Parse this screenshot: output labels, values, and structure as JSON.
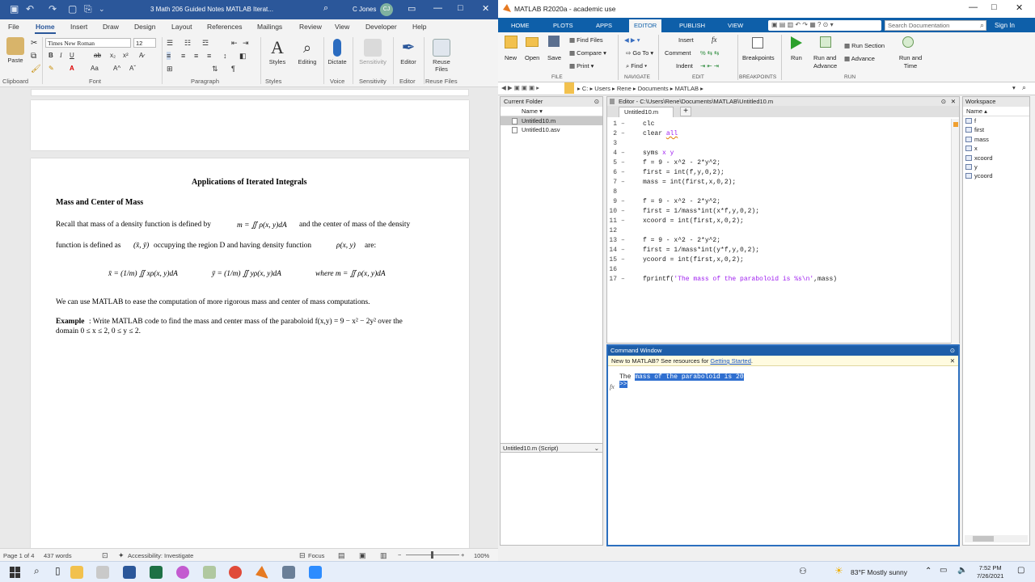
{
  "word": {
    "doc_title": "3 Math 206 Guided Notes MATLAB Iterat...",
    "user": "C Jones",
    "avatar": "CJ",
    "menu": [
      "File",
      "Home",
      "Insert",
      "Draw",
      "Design",
      "Layout",
      "References",
      "Mailings",
      "Review",
      "View",
      "Developer",
      "Help"
    ],
    "font_name": "Times New Roman",
    "font_size": "12",
    "groups": {
      "clipboard": "Clipboard",
      "font": "Font",
      "paragraph": "Paragraph",
      "styles": "Styles",
      "voice": "Voice",
      "sensitivity": "Sensitivity",
      "editor": "Editor",
      "reuse": "Reuse Files"
    },
    "buttons": {
      "paste": "Paste",
      "styles": "Styles",
      "editing": "Editing",
      "dictate": "Dictate",
      "sensitivity": "Sensitivity",
      "editor": "Editor",
      "reuse": "Reuse Files"
    },
    "doc": {
      "heading": "Applications of Iterated Integrals",
      "subheading": "Mass and Center of Mass",
      "p1a": "Recall that mass of a density function is defined by",
      "p1b": "m = ∬ ρ(x, y)dA",
      "p1c": "and the center of mass of the density",
      "p2a": "function is defined as",
      "p2b": "(x̄, ȳ)",
      "p2c": "occupying the region D and having density function",
      "p2d": "ρ(x, y)",
      "p2e": "are:",
      "eq1": "x̄ = (1/m) ∬ xρ(x, y)dA",
      "eq2": "ȳ = (1/m) ∬ yρ(x, y)dA",
      "eq3": "where  m = ∬ ρ(x, y)dA",
      "p3": "We can use MATLAB to ease the computation of more rigorous mass and center of mass computations.",
      "ex_label": "Example",
      "ex_text": ": Write MATLAB code to find the mass and center mass of the paraboloid f(x,y) = 9 − x² − 2y² over the",
      "ex_text2": "domain 0 ≤ x ≤ 2, 0 ≤ y ≤ 2."
    },
    "status": {
      "page": "Page 1 of 4",
      "words": "437 words",
      "accessibility": "Accessibility: Investigate",
      "focus": "Focus",
      "zoom": "100%"
    }
  },
  "matlab": {
    "title": "MATLAB R2020a - academic use",
    "tabs": [
      "HOME",
      "PLOTS",
      "APPS",
      "EDITOR",
      "PUBLISH",
      "VIEW"
    ],
    "search_placeholder": "Search Documentation",
    "signin": "Sign In",
    "ribbon": {
      "new": "New",
      "open": "Open",
      "save": "Save",
      "find_files": "Find Files",
      "compare": "Compare",
      "print": "Print",
      "goto": "Go To",
      "find": "Find",
      "insert": "Insert",
      "fx": "fx",
      "comment": "Comment",
      "indent": "Indent",
      "breakpoints": "Breakpoints",
      "run": "Run",
      "run_advance": "Run and Advance",
      "run_section": "Run Section",
      "advance": "Advance",
      "run_time": "Run and Time",
      "g_file": "FILE",
      "g_navigate": "NAVIGATE",
      "g_edit": "EDIT",
      "g_breakpoints": "BREAKPOINTS",
      "g_run": "RUN"
    },
    "path": [
      "C:",
      "Users",
      "Rene",
      "Documents",
      "MATLAB"
    ],
    "current_folder": {
      "title": "Current Folder",
      "col": "Name",
      "files": [
        "Untitled10.m",
        "Untitled10.asv"
      ],
      "detail": "Untitled10.m  (Script)"
    },
    "editor": {
      "title": "Editor - C:\\Users\\Rene\\Documents\\MATLAB\\Untitled10.m",
      "tab": "Untitled10.m"
    },
    "workspace": {
      "title": "Workspace",
      "col": "Name",
      "vars": [
        "f",
        "first",
        "mass",
        "x",
        "xcoord",
        "y",
        "ycoord"
      ]
    },
    "command": {
      "title": "Command Window",
      "banner": "New to MATLAB? See resources for ",
      "banner_link": "Getting Started",
      "banner_end": ".",
      "out_a": "The ",
      "out_b": "mass of the paraboloid is 20",
      "prompt": ">>"
    }
  },
  "taskbar": {
    "weather": "83°F  Mostly sunny",
    "time": "7:52 PM",
    "date": "7/26/2021"
  }
}
